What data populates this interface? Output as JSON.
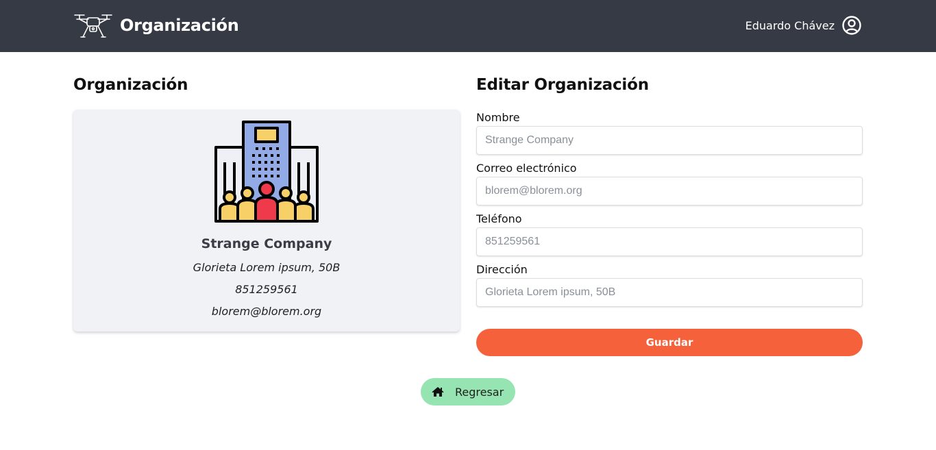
{
  "navbar": {
    "brand_icon": "drone-icon",
    "title": "Organización",
    "user_name": "Eduardo Chávez",
    "user_icon": "user-circle-icon",
    "background": "#363a45"
  },
  "left": {
    "heading": "Organización",
    "card": {
      "illustration": "office-building-team-icon",
      "name": "Strange Company",
      "address": "Glorieta Lorem ipsum, 50B",
      "phone": "851259561",
      "email": "blorem@blorem.org"
    }
  },
  "form": {
    "heading": "Editar Organización",
    "fields": [
      {
        "label": "Nombre",
        "placeholder": "Strange Company"
      },
      {
        "label": "Correo electrónico",
        "placeholder": "blorem@blorem.org"
      },
      {
        "label": "Teléfono",
        "placeholder": "851259561"
      },
      {
        "label": "Dirección",
        "placeholder": "Glorieta Lorem ipsum, 50B"
      }
    ],
    "save_label": "Guardar",
    "save_color": "#f4613b"
  },
  "back": {
    "icon": "home-icon",
    "label": "Regresar",
    "color": "#96e4b1"
  }
}
